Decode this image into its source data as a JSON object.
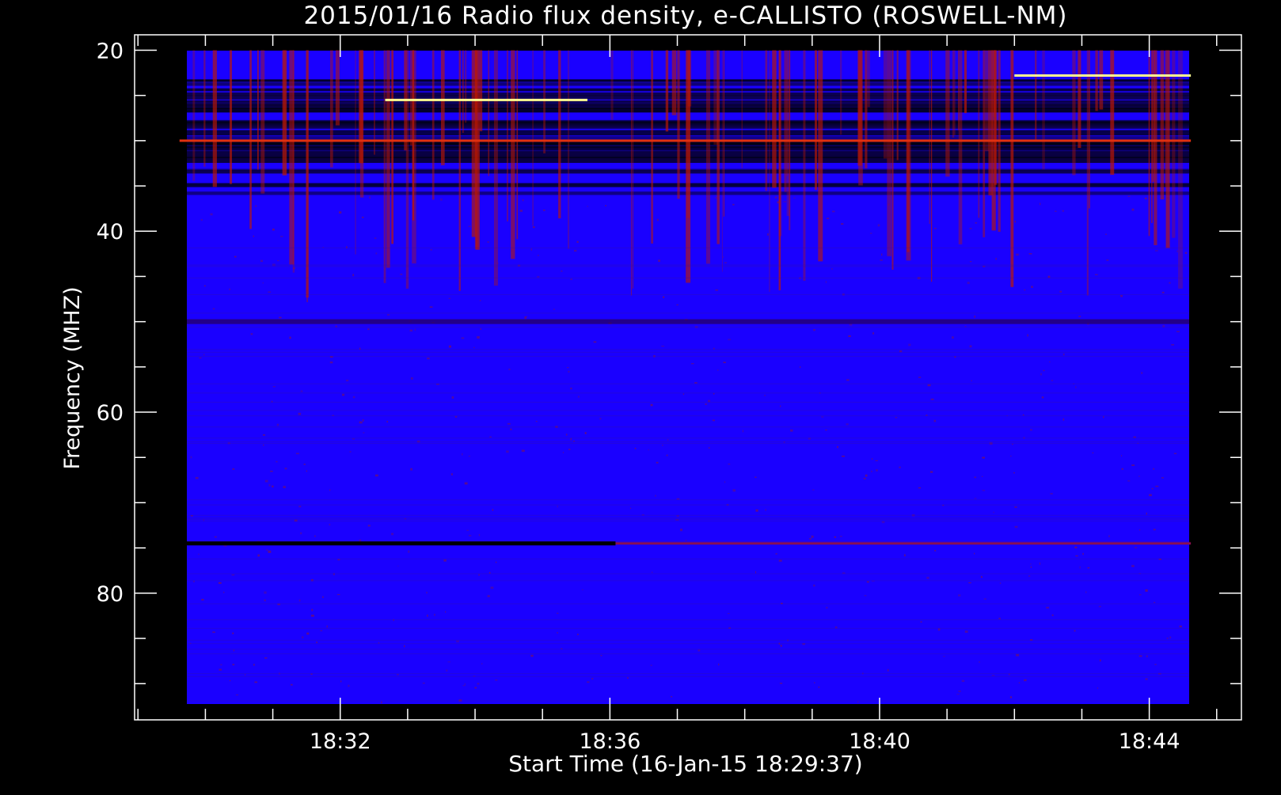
{
  "colors": {
    "background": "#000000",
    "axis": "#ffffff",
    "spectrum_base": "#1a00ff",
    "burst": "#c01800",
    "hot": "#ffff90"
  },
  "chart_data": {
    "type": "heatmap",
    "title": "2015/01/16  Radio flux density, e-CALLISTO (ROSWELL-NM)",
    "xlabel": "Start Time (16-Jan-15 18:29:37)",
    "ylabel": "Frequency (MHZ)",
    "x_unit": "UT time",
    "x_data_range": [
      "18:29:37",
      "18:44:37"
    ],
    "x_axis_range": [
      "18:28:57",
      "18:45:22"
    ],
    "x_major_ticks": [
      "18:32",
      "18:36",
      "18:40",
      "18:44"
    ],
    "y_range": [
      20,
      92
    ],
    "y_axis_range": [
      18.3,
      94.0
    ],
    "y_major_ticks": [
      20,
      40,
      60,
      80
    ],
    "y_minor_tick_step": 5,
    "y_inverted": true,
    "colormap": "blue-red-yellow",
    "features": [
      {
        "kind": "interference_band",
        "freq_mhz_range": [
          22,
          36
        ],
        "intensity": "high"
      },
      {
        "kind": "strong_line",
        "freq_mhz": 25.5,
        "time_range": [
          "18:32:40",
          "18:35:40"
        ]
      },
      {
        "kind": "strong_line",
        "freq_mhz": 22.8,
        "time_range": [
          "18:42:00",
          "18:44:37"
        ]
      },
      {
        "kind": "strong_line",
        "freq_mhz": 30.0,
        "time_range": [
          "18:29:37",
          "18:44:37"
        ]
      },
      {
        "kind": "dark_line",
        "freq_mhz": 74.5,
        "time_range": [
          "18:29:37",
          "18:36:05"
        ]
      },
      {
        "kind": "faint_line",
        "freq_mhz": 74.5,
        "time_range": [
          "18:36:05",
          "18:44:37"
        ]
      },
      {
        "kind": "noise_band",
        "freq_mhz": 50
      }
    ]
  }
}
